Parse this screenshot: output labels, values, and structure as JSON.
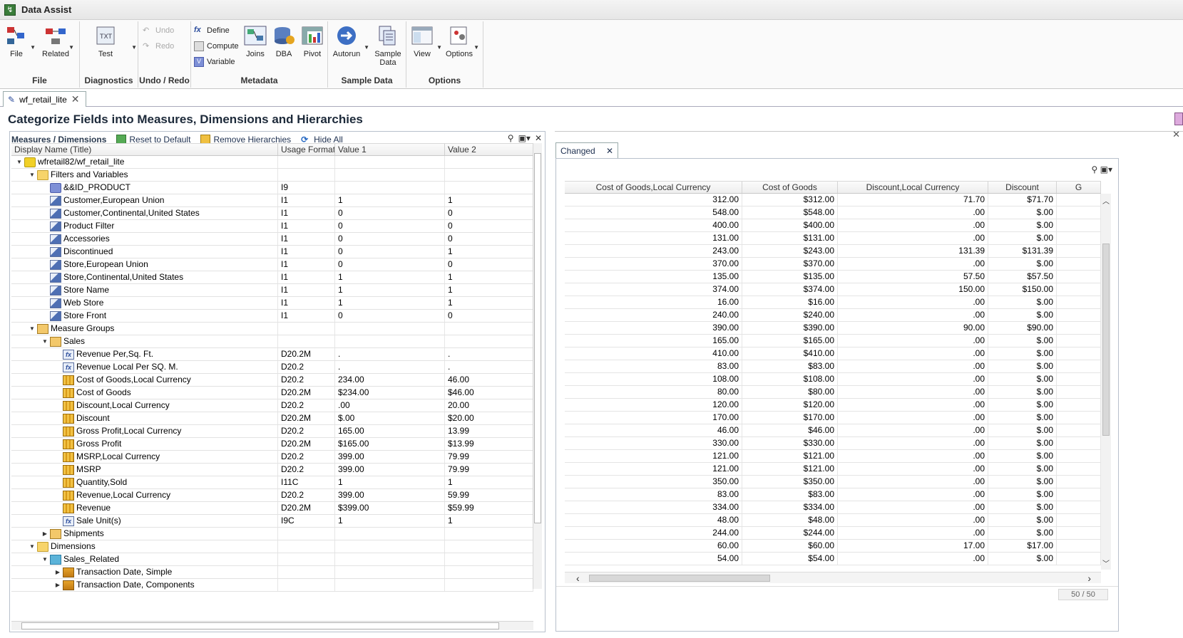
{
  "app": {
    "title": "Data Assist"
  },
  "ribbon": {
    "groups": {
      "file": "File",
      "diagnostics": "Diagnostics",
      "undo_redo": "Undo / Redo",
      "metadata": "Metadata",
      "sample_data": "Sample Data",
      "options": "Options"
    },
    "buttons": {
      "file": "File",
      "related": "Related",
      "test": "Test",
      "undo": "Undo",
      "redo": "Redo",
      "define": "Define",
      "compute": "Compute",
      "variable": "Variable",
      "joins": "Joins",
      "dba": "DBA",
      "pivot": "Pivot",
      "autorun": "Autorun",
      "sample_data_line1": "Sample",
      "sample_data_line2": "Data",
      "view": "View",
      "options": "Options"
    }
  },
  "doc_tab": {
    "label": "wf_retail_lite"
  },
  "heading": "Categorize Fields into Measures, Dimensions and Hierarchies",
  "left_panel": {
    "title": "Measures / Dimensions",
    "reset": "Reset to Default",
    "remove": "Remove Hierarchies",
    "hide": "Hide All",
    "columns": [
      "Display Name (Title)",
      "Usage Format",
      "Value 1",
      "Value 2"
    ],
    "rows": [
      {
        "name": "wfretail82/wf_retail_lite",
        "fmt": "",
        "v1": "",
        "v2": ""
      },
      {
        "name": "Filters and Variables",
        "fmt": "",
        "v1": "",
        "v2": ""
      },
      {
        "name": "&&ID_PRODUCT",
        "fmt": "I9",
        "v1": "",
        "v2": ""
      },
      {
        "name": "Customer,European Union",
        "fmt": "I1",
        "v1": "1",
        "v2": "1"
      },
      {
        "name": "Customer,Continental,United States",
        "fmt": "I1",
        "v1": "0",
        "v2": "0"
      },
      {
        "name": "Product Filter",
        "fmt": "I1",
        "v1": "0",
        "v2": "0"
      },
      {
        "name": "Accessories",
        "fmt": "I1",
        "v1": "0",
        "v2": "0"
      },
      {
        "name": "Discontinued",
        "fmt": "I1",
        "v1": "0",
        "v2": "1"
      },
      {
        "name": "Store,European Union",
        "fmt": "I1",
        "v1": "0",
        "v2": "0"
      },
      {
        "name": "Store,Continental,United States",
        "fmt": "I1",
        "v1": "1",
        "v2": "1"
      },
      {
        "name": "Store Name",
        "fmt": "I1",
        "v1": "1",
        "v2": "1"
      },
      {
        "name": "Web Store",
        "fmt": "I1",
        "v1": "1",
        "v2": "1"
      },
      {
        "name": "Store Front",
        "fmt": "I1",
        "v1": "0",
        "v2": "0"
      },
      {
        "name": "Measure Groups",
        "fmt": "",
        "v1": "",
        "v2": ""
      },
      {
        "name": "Sales",
        "fmt": "",
        "v1": "",
        "v2": ""
      },
      {
        "name": "Revenue Per,Sq. Ft.",
        "fmt": "D20.2M",
        "v1": ".",
        "v2": "."
      },
      {
        "name": "Revenue Local Per SQ. M.",
        "fmt": "D20.2",
        "v1": ".",
        "v2": "."
      },
      {
        "name": "Cost of Goods,Local Currency",
        "fmt": "D20.2",
        "v1": "234.00",
        "v2": "46.00"
      },
      {
        "name": "Cost of Goods",
        "fmt": "D20.2M",
        "v1": "$234.00",
        "v2": "$46.00"
      },
      {
        "name": "Discount,Local Currency",
        "fmt": "D20.2",
        "v1": ".00",
        "v2": "20.00"
      },
      {
        "name": "Discount",
        "fmt": "D20.2M",
        "v1": "$.00",
        "v2": "$20.00"
      },
      {
        "name": "Gross Profit,Local Currency",
        "fmt": "D20.2",
        "v1": "165.00",
        "v2": "13.99"
      },
      {
        "name": "Gross Profit",
        "fmt": "D20.2M",
        "v1": "$165.00",
        "v2": "$13.99"
      },
      {
        "name": "MSRP,Local Currency",
        "fmt": "D20.2",
        "v1": "399.00",
        "v2": "79.99"
      },
      {
        "name": "MSRP",
        "fmt": "D20.2",
        "v1": "399.00",
        "v2": "79.99"
      },
      {
        "name": "Quantity,Sold",
        "fmt": "I11C",
        "v1": "1",
        "v2": "1"
      },
      {
        "name": "Revenue,Local Currency",
        "fmt": "D20.2",
        "v1": "399.00",
        "v2": "59.99"
      },
      {
        "name": "Revenue",
        "fmt": "D20.2M",
        "v1": "$399.00",
        "v2": "$59.99"
      },
      {
        "name": "Sale Unit(s)",
        "fmt": "I9C",
        "v1": "1",
        "v2": "1"
      },
      {
        "name": "Shipments",
        "fmt": "",
        "v1": "",
        "v2": ""
      },
      {
        "name": "Dimensions",
        "fmt": "",
        "v1": "",
        "v2": ""
      },
      {
        "name": "Sales_Related",
        "fmt": "",
        "v1": "",
        "v2": ""
      },
      {
        "name": "Transaction Date, Simple",
        "fmt": "",
        "v1": "",
        "v2": ""
      },
      {
        "name": "Transaction Date, Components",
        "fmt": "",
        "v1": "",
        "v2": ""
      }
    ]
  },
  "right_panel": {
    "tab": "Changed",
    "columns": [
      "Cost of Goods,Local Currency",
      "Cost of Goods",
      "Discount,Local Currency",
      "Discount",
      "G"
    ],
    "rows": [
      [
        "312.00",
        "$312.00",
        "71.70",
        "$71.70"
      ],
      [
        "548.00",
        "$548.00",
        ".00",
        "$.00"
      ],
      [
        "400.00",
        "$400.00",
        ".00",
        "$.00"
      ],
      [
        "131.00",
        "$131.00",
        ".00",
        "$.00"
      ],
      [
        "243.00",
        "$243.00",
        "131.39",
        "$131.39"
      ],
      [
        "370.00",
        "$370.00",
        ".00",
        "$.00"
      ],
      [
        "135.00",
        "$135.00",
        "57.50",
        "$57.50"
      ],
      [
        "374.00",
        "$374.00",
        "150.00",
        "$150.00"
      ],
      [
        "16.00",
        "$16.00",
        ".00",
        "$.00"
      ],
      [
        "240.00",
        "$240.00",
        ".00",
        "$.00"
      ],
      [
        "390.00",
        "$390.00",
        "90.00",
        "$90.00"
      ],
      [
        "165.00",
        "$165.00",
        ".00",
        "$.00"
      ],
      [
        "410.00",
        "$410.00",
        ".00",
        "$.00"
      ],
      [
        "83.00",
        "$83.00",
        ".00",
        "$.00"
      ],
      [
        "108.00",
        "$108.00",
        ".00",
        "$.00"
      ],
      [
        "80.00",
        "$80.00",
        ".00",
        "$.00"
      ],
      [
        "120.00",
        "$120.00",
        ".00",
        "$.00"
      ],
      [
        "170.00",
        "$170.00",
        ".00",
        "$.00"
      ],
      [
        "46.00",
        "$46.00",
        ".00",
        "$.00"
      ],
      [
        "330.00",
        "$330.00",
        ".00",
        "$.00"
      ],
      [
        "121.00",
        "$121.00",
        ".00",
        "$.00"
      ],
      [
        "121.00",
        "$121.00",
        ".00",
        "$.00"
      ],
      [
        "350.00",
        "$350.00",
        ".00",
        "$.00"
      ],
      [
        "83.00",
        "$83.00",
        ".00",
        "$.00"
      ],
      [
        "334.00",
        "$334.00",
        ".00",
        "$.00"
      ],
      [
        "48.00",
        "$48.00",
        ".00",
        "$.00"
      ],
      [
        "244.00",
        "$244.00",
        ".00",
        "$.00"
      ],
      [
        "60.00",
        "$60.00",
        "17.00",
        "$17.00"
      ],
      [
        "54.00",
        "$54.00",
        ".00",
        "$.00"
      ]
    ],
    "pager": "50 / 50"
  }
}
